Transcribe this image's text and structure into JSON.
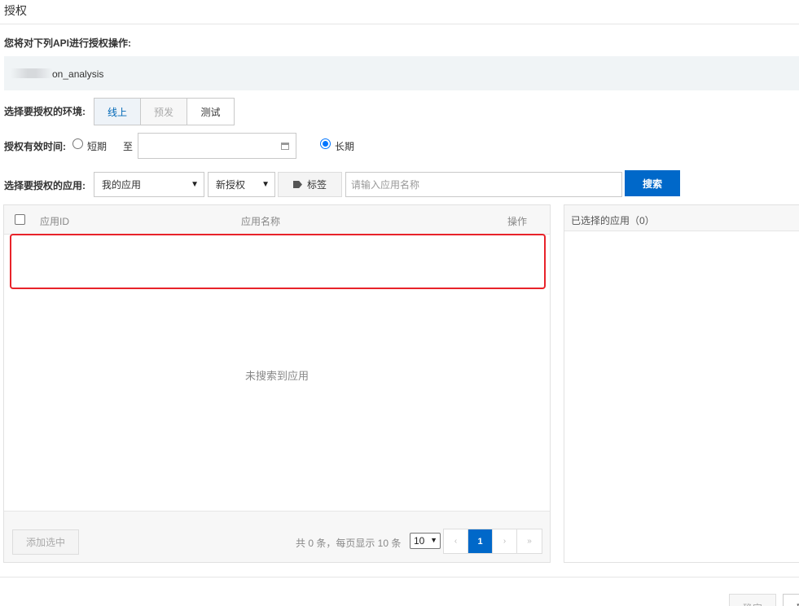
{
  "dialog": {
    "title": "授权"
  },
  "api_section": {
    "label": "您将对下列API进行授权操作:",
    "api_name": "on_analysis"
  },
  "environment": {
    "label": "选择要授权的环境:",
    "options": [
      "线上",
      "预发",
      "测试"
    ],
    "selected": "线上"
  },
  "validity": {
    "label": "授权有效时间:",
    "short_label": "短期",
    "to_label": "至",
    "long_label": "长期",
    "selected": "长期",
    "date_value": ""
  },
  "app_filter": {
    "label": "选择要授权的应用:",
    "app_select": "我的应用",
    "auth_select": "新授权",
    "tag_label": "标签",
    "search_placeholder": "请输入应用名称",
    "search_button": "搜索"
  },
  "table": {
    "columns": [
      "应用ID",
      "应用名称",
      "操作"
    ],
    "empty_text": "未搜索到应用",
    "add_selected_button": "添加选中",
    "pager_info": "共 0 条，每页显示 10 条",
    "page_size": "10",
    "pages": [
      "‹",
      "1",
      "›",
      "»"
    ],
    "current_page": "1"
  },
  "selected_panel": {
    "title": "已选择的应用（0）"
  },
  "footer": {
    "confirm_label": "确定",
    "cancel_label": "取"
  },
  "colors": {
    "primary": "#0068c9",
    "highlight_border": "#e8232a",
    "panel_bg": "#f7f7f7"
  }
}
